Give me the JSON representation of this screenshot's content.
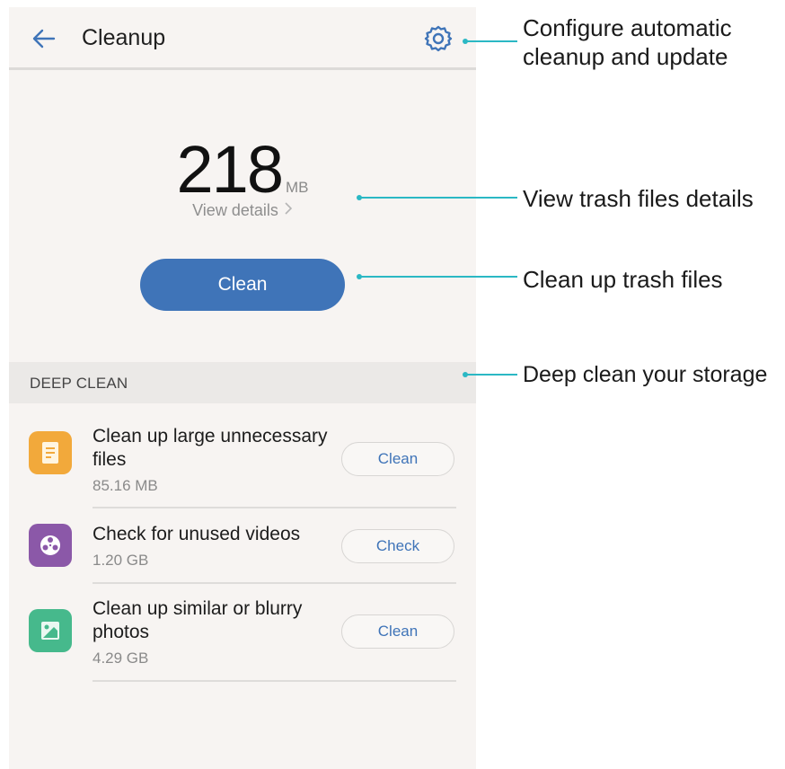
{
  "app": {
    "title": "Cleanup",
    "storage_amount": "218",
    "storage_unit": "MB",
    "view_details_label": "View details",
    "clean_button_label": "Clean"
  },
  "deep_clean": {
    "header": "DEEP CLEAN",
    "items": [
      {
        "title": "Clean up large unnecessary files",
        "size": "85.16 MB",
        "button": "Clean",
        "icon": "document-icon",
        "color": "#f2a93b"
      },
      {
        "title": "Check for unused videos",
        "size": "1.20 GB",
        "button": "Check",
        "icon": "film-reel-icon",
        "color": "#8b58a8"
      },
      {
        "title": "Clean up similar or blurry photos",
        "size": "4.29 GB",
        "button": "Clean",
        "icon": "photo-icon",
        "color": "#46b98c"
      }
    ]
  },
  "annotations": [
    "Configure automatic\ncleanup and update",
    "View trash files details",
    "Clean up trash files",
    "Deep clean your storage"
  ],
  "colors": {
    "accent": "#3f74b8",
    "callout": "#2bb8c4",
    "background": "#f7f4f2"
  }
}
